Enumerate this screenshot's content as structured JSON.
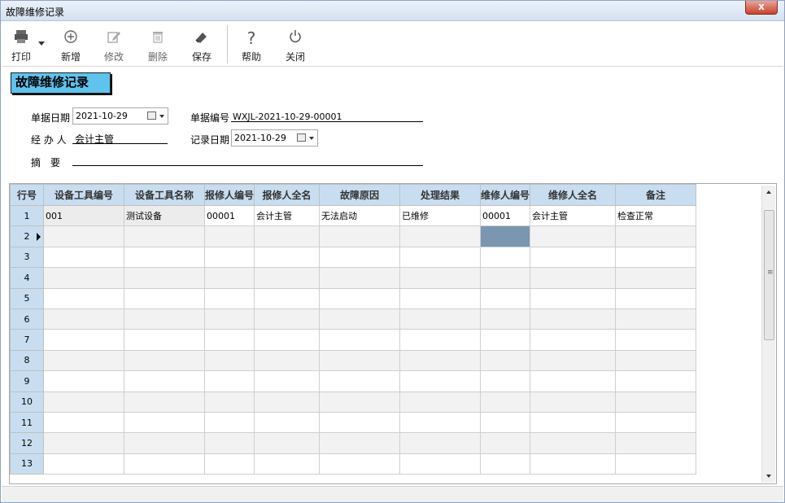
{
  "window": {
    "title": "故障维修记录",
    "close_glyph": "x"
  },
  "toolbar": {
    "print": {
      "label": "打印",
      "icon": "printer-icon"
    },
    "add": {
      "label": "新增",
      "icon": "plus-circle-icon"
    },
    "edit": {
      "label": "修改",
      "icon": "pencil-icon"
    },
    "delete": {
      "label": "删除",
      "icon": "trash-icon"
    },
    "save": {
      "label": "保存",
      "icon": "eraser-icon"
    },
    "help": {
      "label": "帮助",
      "icon": "question-icon"
    },
    "close": {
      "label": "关闭",
      "icon": "power-icon"
    }
  },
  "form": {
    "title": "故障维修记录",
    "doc_date_label": "单据日期",
    "doc_date": "2021-10-29",
    "doc_no_label": "单据编号",
    "doc_no": "WXJL-2021-10-29-00001",
    "handler_label": "经 办 人",
    "handler": "会计主管",
    "record_date_label": "记录日期",
    "record_date": "2021-10-29",
    "summary_label": "摘　要",
    "summary": ""
  },
  "grid": {
    "columns": [
      "行号",
      "设备工具编号",
      "设备工具名称",
      "报修人编号",
      "报修人全名",
      "故障原因",
      "处理结果",
      "维修人编号",
      "维修人全名",
      "备注"
    ],
    "rows": [
      [
        "1",
        "001",
        "测试设备",
        "00001",
        "会计主管",
        "无法启动",
        "已维修",
        "00001",
        "会计主管",
        "检查正常"
      ],
      [
        "2",
        "",
        "",
        "",
        "",
        "",
        "",
        "",
        "",
        ""
      ],
      [
        "3",
        "",
        "",
        "",
        "",
        "",
        "",
        "",
        "",
        ""
      ],
      [
        "4",
        "",
        "",
        "",
        "",
        "",
        "",
        "",
        "",
        ""
      ],
      [
        "5",
        "",
        "",
        "",
        "",
        "",
        "",
        "",
        "",
        ""
      ],
      [
        "6",
        "",
        "",
        "",
        "",
        "",
        "",
        "",
        "",
        ""
      ],
      [
        "7",
        "",
        "",
        "",
        "",
        "",
        "",
        "",
        "",
        ""
      ],
      [
        "8",
        "",
        "",
        "",
        "",
        "",
        "",
        "",
        "",
        ""
      ],
      [
        "9",
        "",
        "",
        "",
        "",
        "",
        "",
        "",
        "",
        ""
      ],
      [
        "10",
        "",
        "",
        "",
        "",
        "",
        "",
        "",
        "",
        ""
      ],
      [
        "11",
        "",
        "",
        "",
        "",
        "",
        "",
        "",
        "",
        ""
      ],
      [
        "12",
        "",
        "",
        "",
        "",
        "",
        "",
        "",
        "",
        ""
      ],
      [
        "13",
        "",
        "",
        "",
        "",
        "",
        "",
        "",
        "",
        ""
      ]
    ],
    "current_row": 2,
    "selected_cell": {
      "row": 2,
      "col": 7
    }
  },
  "colors": {
    "form_title_bg": "#5fc3ee",
    "grid_header_bg": "#c8def0",
    "selected_cell": "#7a96b0"
  }
}
